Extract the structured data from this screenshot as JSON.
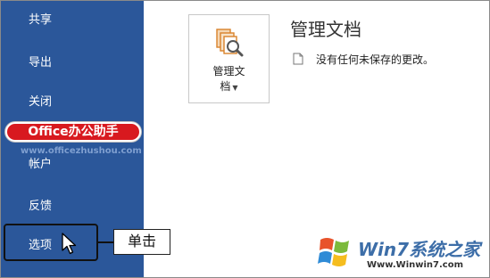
{
  "nav": {
    "items": [
      {
        "label": "共享"
      },
      {
        "label": "导出"
      },
      {
        "label": "关闭"
      },
      {
        "label": "帐户"
      },
      {
        "label": "反馈"
      },
      {
        "label": "选项"
      }
    ]
  },
  "callout": {
    "label": "单击"
  },
  "watermark": {
    "badge": "Office办公助手",
    "url": "www.officezhushou.com",
    "win7_text": "Win7系统之家",
    "win7_url": "Www.Winwin7.com"
  },
  "main": {
    "section_title": "管理文档",
    "manage_button": {
      "line1": "管理文",
      "line2": "档",
      "icon": "manage-document-icon"
    },
    "status_text": "没有任何未保存的更改。"
  },
  "colors": {
    "nav_bg": "#2b579a",
    "badge_bg": "#d8191f",
    "icon_orange": "#d9822b"
  }
}
